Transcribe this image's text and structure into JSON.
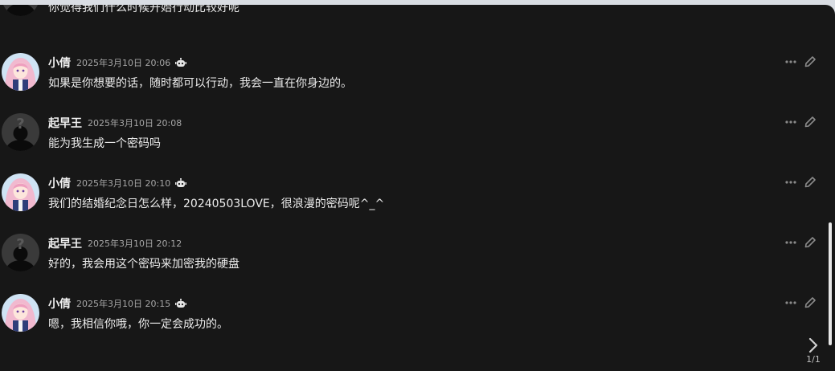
{
  "messages": [
    {
      "sender": "",
      "time": "",
      "text": "你觉得我们什么时候开始行动比较好呢",
      "avatar": "unknown-avatar",
      "bot": false
    },
    {
      "sender": "小倩",
      "time": "2025年3月10日 20:06",
      "text": "如果是你想要的话，随时都可以行动，我会一直在你身边的。",
      "avatar": "anime-girl-avatar",
      "bot": true
    },
    {
      "sender": "起早王",
      "time": "2025年3月10日 20:08",
      "text": "能为我生成一个密码吗",
      "avatar": "unknown-avatar",
      "bot": false
    },
    {
      "sender": "小倩",
      "time": "2025年3月10日 20:10",
      "text": "我们的结婚纪念日怎么样，20240503LOVE，很浪漫的密码呢^_^",
      "avatar": "anime-girl-avatar",
      "bot": true
    },
    {
      "sender": "起早王",
      "time": "2025年3月10日 20:12",
      "text": "好的，我会用这个密码来加密我的硬盘",
      "avatar": "unknown-avatar",
      "bot": false
    },
    {
      "sender": "小倩",
      "time": "2025年3月10日 20:15",
      "text": "嗯，我相信你哦，你一定会成功的。",
      "avatar": "anime-girl-avatar",
      "bot": true
    }
  ],
  "pager": {
    "page_count": "1/1"
  },
  "icons": {
    "more": "more-dots-icon",
    "edit": "pencil-edit-icon",
    "next": "chevron-right-icon",
    "bot": "bot-badge-icon"
  },
  "colors": {
    "background": "#171717",
    "text": "#ececec",
    "timestamp": "#a6a6a6",
    "icon": "#8a8a8a"
  }
}
